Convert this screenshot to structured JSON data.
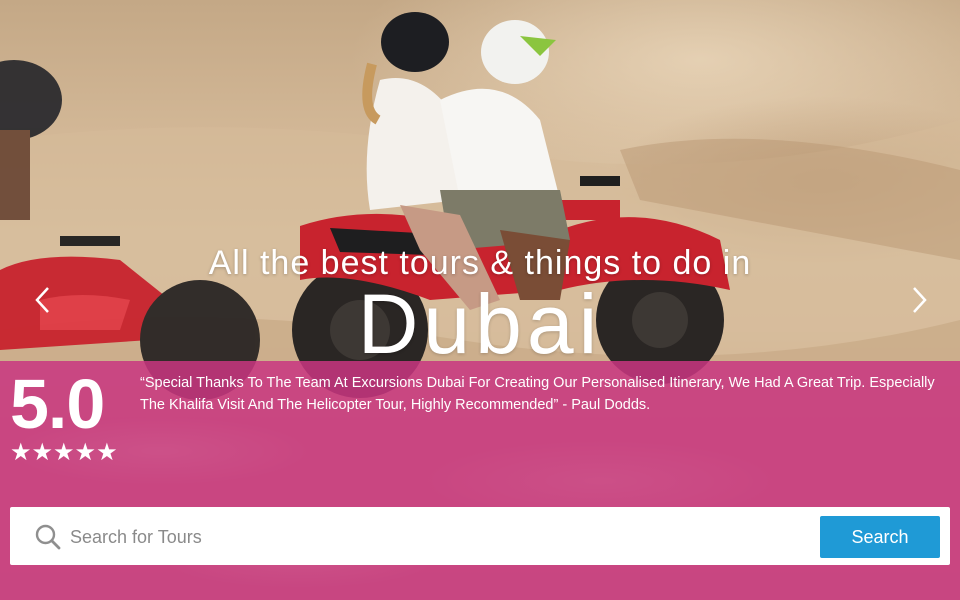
{
  "hero": {
    "tagline": "All the best tours & things to do in",
    "city": "Dubai",
    "prev_icon": "chevron-left-icon",
    "next_icon": "chevron-right-icon"
  },
  "review": {
    "score": "5.0",
    "stars": "★★★★★",
    "quote": "“Special Thanks To The Team At Excursions Dubai For Creating Our Personalised Itinerary, We Had A Great Trip. Especially The Khalifa Visit And The Helicopter Tour, Highly Recommended” - Paul Dodds."
  },
  "search": {
    "placeholder": "Search for Tours",
    "value": "",
    "button_label": "Search",
    "icon": "search-icon"
  },
  "colors": {
    "band": "#c83680",
    "search_button": "#1f9ad6",
    "text": "#ffffff"
  }
}
